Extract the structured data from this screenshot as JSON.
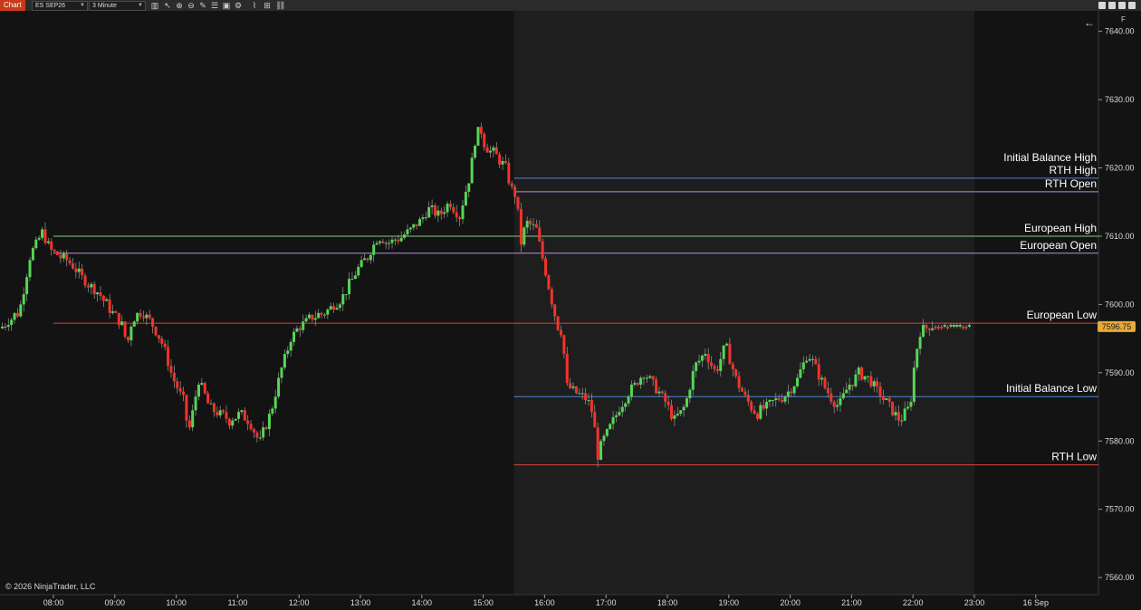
{
  "toolbar": {
    "chart_tab": "Chart",
    "instrument": "ES SEP26",
    "interval": "3 Minute"
  },
  "window_buttons": [
    "minimize-icon",
    "restore-icon",
    "maximize-icon",
    "close-icon"
  ],
  "toolbar_icons": [
    "bars-icon",
    "pointer-icon",
    "zoom-in-icon",
    "zoom-out-icon",
    "draw-icon",
    "properties-icon",
    "data-box-icon",
    "strategies-icon",
    "indicators-icon",
    "templates-icon"
  ],
  "copyright": "© 2026 NinjaTrader, LLC",
  "back_arrow": "←",
  "scale_flag": "F",
  "colors": {
    "up": "#55d655",
    "down": "#f2332a",
    "background": "#131313",
    "rth_background": "#1e1e1e",
    "blue": "#4f86d6",
    "purple": "#b48fe0",
    "green": "#7fcf7f",
    "red": "#d9453d",
    "price_marker": "#e8a93a"
  },
  "chart_data": {
    "type": "candlestick",
    "instrument": "ES SEP26",
    "interval": "3 Minute",
    "ylim": [
      7557.5,
      7643
    ],
    "y_ticks": [
      "7640.00",
      "7630.00",
      "7620.00",
      "7610.00",
      "7600.00",
      "7590.00",
      "7580.00",
      "7570.00",
      "7560.00"
    ],
    "x_ticks": [
      "08:00",
      "09:00",
      "10:00",
      "11:00",
      "12:00",
      "13:00",
      "14:00",
      "15:00",
      "16:00",
      "17:00",
      "18:00",
      "19:00",
      "20:00",
      "21:00",
      "22:00",
      "23:00",
      "16 Sep"
    ],
    "current_price": "7596.75",
    "levels": [
      {
        "name": "RTH High",
        "value": 7618.5,
        "color": "#4f86d6",
        "line": "none"
      },
      {
        "name": "Initial Balance High",
        "value": 7618.5,
        "color": "#4f86d6",
        "line": "rth"
      },
      {
        "name": "RTH Open",
        "value": 7616.5,
        "color": "#b48fe0",
        "line": "rth"
      },
      {
        "name": "European High",
        "value": 7610.0,
        "color": "#7fcf7f",
        "line": "full"
      },
      {
        "name": "European Open",
        "value": 7607.5,
        "color": "#b48fe0",
        "line": "full"
      },
      {
        "name": "European Low",
        "value": 7597.25,
        "color": "#d9453d",
        "line": "full"
      },
      {
        "name": "Initial Balance Low",
        "value": 7586.5,
        "color": "#4f86d6",
        "line": "rth"
      },
      {
        "name": "RTH Low",
        "value": 7576.5,
        "color": "#d9453d",
        "line": "rth"
      }
    ],
    "price_path": [
      [
        "07:10",
        7596.5
      ],
      [
        "07:30",
        7599
      ],
      [
        "07:40",
        7607
      ],
      [
        "07:47",
        7609
      ],
      [
        "07:52",
        7610.5
      ],
      [
        "08:00",
        7608
      ],
      [
        "08:10",
        7607
      ],
      [
        "08:20",
        7606
      ],
      [
        "08:30",
        7604
      ],
      [
        "08:45",
        7602
      ],
      [
        "09:00",
        7599
      ],
      [
        "09:10",
        7597
      ],
      [
        "09:15",
        7594
      ],
      [
        "09:20",
        7598
      ],
      [
        "09:30",
        7599
      ],
      [
        "09:40",
        7597
      ],
      [
        "09:50",
        7594
      ],
      [
        "10:00",
        7589
      ],
      [
        "10:10",
        7586
      ],
      [
        "10:15",
        7581
      ],
      [
        "10:25",
        7589
      ],
      [
        "10:35",
        7585
      ],
      [
        "10:45",
        7584
      ],
      [
        "10:55",
        7583
      ],
      [
        "11:05",
        7584
      ],
      [
        "11:15",
        7583
      ],
      [
        "11:20",
        7581
      ],
      [
        "11:25",
        7580
      ],
      [
        "11:35",
        7584
      ],
      [
        "11:45",
        7590
      ],
      [
        "11:55",
        7595
      ],
      [
        "12:05",
        7597
      ],
      [
        "12:15",
        7598
      ],
      [
        "12:30",
        7599
      ],
      [
        "12:45",
        7601
      ],
      [
        "13:00",
        7605
      ],
      [
        "13:10",
        7607
      ],
      [
        "13:20",
        7610
      ],
      [
        "13:30",
        7609
      ],
      [
        "13:45",
        7610
      ],
      [
        "14:00",
        7612
      ],
      [
        "14:10",
        7614
      ],
      [
        "14:20",
        7613
      ],
      [
        "14:30",
        7615
      ],
      [
        "14:40",
        7613
      ],
      [
        "14:50",
        7619
      ],
      [
        "14:55",
        7624
      ],
      [
        "15:00",
        7626
      ],
      [
        "15:05",
        7623
      ],
      [
        "15:15",
        7622
      ],
      [
        "15:25",
        7620
      ],
      [
        "15:30",
        7617
      ],
      [
        "15:35",
        7616
      ],
      [
        "15:40",
        7609
      ],
      [
        "15:45",
        7612
      ],
      [
        "15:55",
        7611
      ],
      [
        "16:05",
        7604
      ],
      [
        "16:15",
        7597
      ],
      [
        "16:20",
        7596
      ],
      [
        "16:25",
        7588
      ],
      [
        "16:35",
        7587
      ],
      [
        "16:45",
        7586
      ],
      [
        "16:50",
        7584
      ],
      [
        "16:55",
        7578
      ],
      [
        "17:00",
        7580
      ],
      [
        "17:10",
        7583
      ],
      [
        "17:20",
        7586
      ],
      [
        "17:30",
        7588
      ],
      [
        "17:40",
        7590
      ],
      [
        "17:50",
        7588
      ],
      [
        "18:00",
        7586
      ],
      [
        "18:10",
        7583
      ],
      [
        "18:20",
        7585
      ],
      [
        "18:30",
        7591
      ],
      [
        "18:40",
        7593
      ],
      [
        "18:50",
        7590
      ],
      [
        "19:00",
        7594
      ],
      [
        "19:10",
        7589
      ],
      [
        "19:20",
        7586
      ],
      [
        "19:30",
        7584
      ],
      [
        "19:40",
        7585
      ],
      [
        "19:50",
        7586
      ],
      [
        "20:00",
        7587
      ],
      [
        "20:10",
        7589
      ],
      [
        "20:20",
        7593
      ],
      [
        "20:30",
        7590
      ],
      [
        "20:40",
        7587
      ],
      [
        "20:50",
        7585
      ],
      [
        "21:00",
        7588
      ],
      [
        "21:10",
        7590
      ],
      [
        "21:20",
        7589
      ],
      [
        "21:30",
        7587
      ],
      [
        "21:40",
        7585
      ],
      [
        "21:50",
        7583
      ],
      [
        "22:00",
        7585
      ],
      [
        "22:05",
        7592
      ],
      [
        "22:10",
        7596
      ],
      [
        "22:20",
        7597
      ],
      [
        "22:40",
        7596.75
      ],
      [
        "22:55",
        7596.75
      ]
    ]
  }
}
